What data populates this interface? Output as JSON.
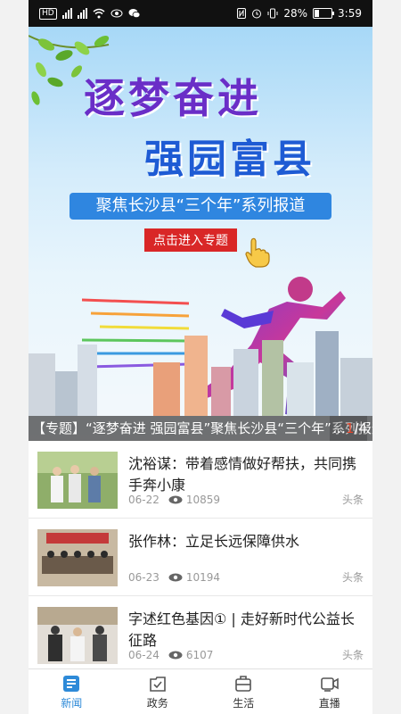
{
  "status": {
    "left_icons": [
      "hd-icon",
      "signal-4g-icon",
      "signal-4g-icon",
      "wifi-icon",
      "eye-icon",
      "wechat-icon"
    ],
    "battery": "28%",
    "time": "3:59"
  },
  "banner": {
    "title_line1": "逐梦奋进",
    "title_line2": "强园富县",
    "subtitle": "聚焦长沙县“三个年”系列报道",
    "enter_button": "点击进入专题",
    "caption": "【专题】“逐梦奋进 强园富县”聚焦长沙县“三个年”系列报道",
    "caption_ellipsis": "...",
    "current": "1",
    "total": "/4"
  },
  "news": [
    {
      "title": "沈裕谋：带着感情做好帮扶，共同携手奔小康",
      "date": "06-22",
      "views": "10859",
      "tag": "头条"
    },
    {
      "title": "张作林：立足长远保障供水",
      "date": "06-23",
      "views": "10194",
      "tag": "头条"
    },
    {
      "title": "字述红色基因① | 走好新时代公益长征路",
      "date": "06-24",
      "views": "6107",
      "tag": "头条"
    }
  ],
  "tabs": [
    {
      "label": "新闻",
      "icon": "news-icon",
      "active": true
    },
    {
      "label": "政务",
      "icon": "government-icon",
      "active": false
    },
    {
      "label": "生活",
      "icon": "life-icon",
      "active": false
    },
    {
      "label": "直播",
      "icon": "live-icon",
      "active": false
    }
  ],
  "colors": {
    "accent": "#2e8ad8",
    "caption_current": "#e0442b"
  }
}
